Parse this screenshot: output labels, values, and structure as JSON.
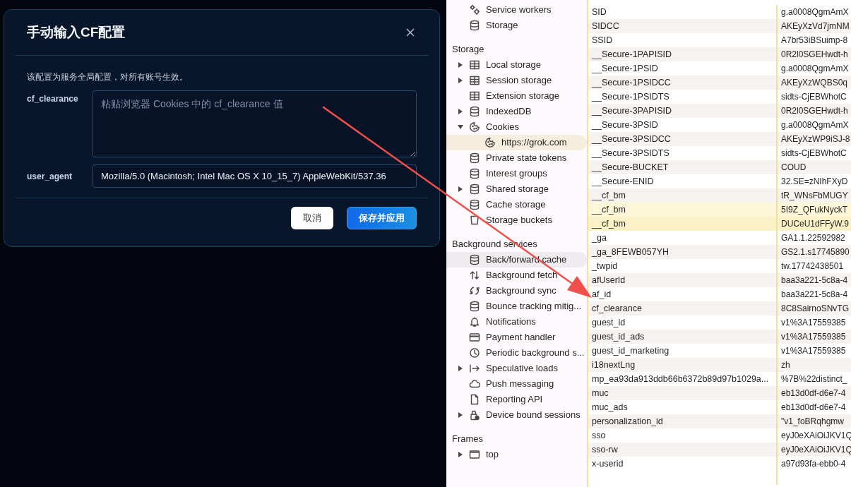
{
  "dialog": {
    "title": "手动输入CF配置",
    "note": "该配置为服务全局配置，对所有账号生效。",
    "fields": [
      {
        "label": "cf_clearance",
        "kind": "textarea",
        "placeholder": "粘贴浏览器 Cookies 中的 cf_clearance 值"
      },
      {
        "label": "user_agent",
        "kind": "input",
        "value": "Mozilla/5.0 (Macintosh; Intel Mac OS X 10_15_7) AppleWebKit/537.36"
      }
    ],
    "buttons": [
      {
        "label": "取消",
        "kind": "secondary"
      },
      {
        "label": "保存并应用",
        "kind": "primary"
      }
    ]
  },
  "sidebar": {
    "sections": [
      {
        "items": [
          {
            "label": "Service workers",
            "kind": "gears",
            "selected": false,
            "hovered": false
          },
          {
            "label": "Storage",
            "kind": "database",
            "selected": false,
            "hovered": false
          }
        ]
      },
      {
        "title": "Storage",
        "items": [
          {
            "label": "Local storage",
            "kind": "table",
            "expanded": false,
            "selected": false,
            "hovered": false
          },
          {
            "label": "Session storage",
            "kind": "table",
            "expanded": false,
            "selected": false,
            "hovered": false
          },
          {
            "label": "Extension storage",
            "kind": "table",
            "selected": false,
            "hovered": false
          },
          {
            "label": "IndexedDB",
            "kind": "database",
            "expanded": false,
            "selected": false,
            "hovered": false
          },
          {
            "label": "Cookies",
            "kind": "cookie",
            "expanded": true,
            "selected": false,
            "hovered": false,
            "children": [
              {
                "label": "https://grok.com",
                "kind": "cookie",
                "selected": true
              }
            ]
          },
          {
            "label": "Private state tokens",
            "kind": "database",
            "selected": false,
            "hovered": false
          },
          {
            "label": "Interest groups",
            "kind": "database",
            "selected": false,
            "hovered": false
          },
          {
            "label": "Shared storage",
            "kind": "database",
            "expanded": false,
            "selected": false,
            "hovered": false
          },
          {
            "label": "Cache storage",
            "kind": "database",
            "selected": false,
            "hovered": false
          },
          {
            "label": "Storage buckets",
            "kind": "bucket",
            "selected": false,
            "hovered": false
          }
        ]
      },
      {
        "title": "Background services",
        "items": [
          {
            "label": "Back/forward cache",
            "kind": "database",
            "selected": false,
            "hovered": true
          },
          {
            "label": "Background fetch",
            "kind": "updown",
            "selected": false,
            "hovered": false
          },
          {
            "label": "Background sync",
            "kind": "sync",
            "selected": false,
            "hovered": false
          },
          {
            "label": "Bounce tracking mitig...",
            "kind": "database",
            "selected": false,
            "hovered": false
          },
          {
            "label": "Notifications",
            "kind": "bell",
            "selected": false,
            "hovered": false
          },
          {
            "label": "Payment handler",
            "kind": "card",
            "selected": false,
            "hovered": false
          },
          {
            "label": "Periodic background s...",
            "kind": "clock",
            "selected": false,
            "hovered": false
          },
          {
            "label": "Speculative loads",
            "kind": "arrow",
            "expanded": false,
            "selected": false,
            "hovered": false
          },
          {
            "label": "Push messaging",
            "kind": "cloud",
            "selected": false,
            "hovered": false
          },
          {
            "label": "Reporting API",
            "kind": "file",
            "selected": false,
            "hovered": false
          },
          {
            "label": "Device bound sessions",
            "kind": "lock",
            "expanded": false,
            "selected": false,
            "hovered": false
          }
        ]
      },
      {
        "title": "Frames",
        "items": [
          {
            "label": "top",
            "kind": "frame",
            "expanded": false,
            "selected": false,
            "hovered": false
          }
        ]
      }
    ]
  },
  "cookies": {
    "rows": [
      {
        "name": "SID",
        "value": "g.a0008QgmAmX",
        "selected": false
      },
      {
        "name": "SIDCC",
        "value": "AKEyXzVd7jmNM",
        "selected": false
      },
      {
        "name": "SSID",
        "value": "A7br53iBSuimp-8",
        "selected": false
      },
      {
        "name": "__Secure-1PAPISID",
        "value": "0R2l0SGEHwdt-h",
        "selected": false
      },
      {
        "name": "__Secure-1PSID",
        "value": "g.a0008QgmAmX",
        "selected": false
      },
      {
        "name": "__Secure-1PSIDCC",
        "value": "AKEyXzWQBS0q",
        "selected": false
      },
      {
        "name": "__Secure-1PSIDTS",
        "value": "sidts-CjEBWhotC",
        "selected": false
      },
      {
        "name": "__Secure-3PAPISID",
        "value": "0R2l0SGEHwdt-h",
        "selected": false
      },
      {
        "name": "__Secure-3PSID",
        "value": "g.a0008QgmAmX",
        "selected": false
      },
      {
        "name": "__Secure-3PSIDCC",
        "value": "AKEyXzWP9iSJ-8",
        "selected": false
      },
      {
        "name": "__Secure-3PSIDTS",
        "value": "sidts-CjEBWhotC",
        "selected": false
      },
      {
        "name": "__Secure-BUCKET",
        "value": "COUD",
        "selected": false
      },
      {
        "name": "__Secure-ENID",
        "value": "32.SE=zNIhFXyD",
        "selected": false
      },
      {
        "name": "__cf_bm",
        "value": "tR_WNsFbMUGY",
        "selected": false
      },
      {
        "name": "__cf_bm",
        "value": "5I9Z_QFukNyckT",
        "selected": true
      },
      {
        "name": "__cf_bm",
        "value": "DUCeU1dFFyW.9",
        "selected": true
      },
      {
        "name": "_ga",
        "value": "GA1.1.22592982",
        "selected": false
      },
      {
        "name": "_ga_8FEWB057YH",
        "value": "GS2.1.s17745890",
        "selected": false
      },
      {
        "name": "_twpid",
        "value": "tw.17742438501",
        "selected": false
      },
      {
        "name": "afUserId",
        "value": "baa3a221-5c8a-4",
        "selected": false
      },
      {
        "name": "af_id",
        "value": "baa3a221-5c8a-4",
        "selected": false
      },
      {
        "name": "cf_clearance",
        "value": "8C8SairnoSNvTG",
        "selected": false
      },
      {
        "name": "guest_id",
        "value": "v1%3A17559385",
        "selected": false
      },
      {
        "name": "guest_id_ads",
        "value": "v1%3A17559385",
        "selected": false
      },
      {
        "name": "guest_id_marketing",
        "value": "v1%3A17559385",
        "selected": false
      },
      {
        "name": "i18nextLng",
        "value": "zh",
        "selected": false
      },
      {
        "name": "mp_ea93da913ddb66b6372b89d97b1029a...",
        "value": "%7B%22distinct_",
        "selected": false
      },
      {
        "name": "muc",
        "value": "eb13d0df-d6e7-4",
        "selected": false
      },
      {
        "name": "muc_ads",
        "value": "eb13d0df-d6e7-4",
        "selected": false
      },
      {
        "name": "personalization_id",
        "value": "\"v1_foBRqhgmw",
        "selected": false
      },
      {
        "name": "sso",
        "value": "eyJ0eXAiOiJKV1Q",
        "selected": false
      },
      {
        "name": "sso-rw",
        "value": "eyJ0eXAiOiJKV1Q",
        "selected": false
      },
      {
        "name": "x-userid",
        "value": "a97d93fa-ebb0-4",
        "selected": false
      }
    ]
  }
}
